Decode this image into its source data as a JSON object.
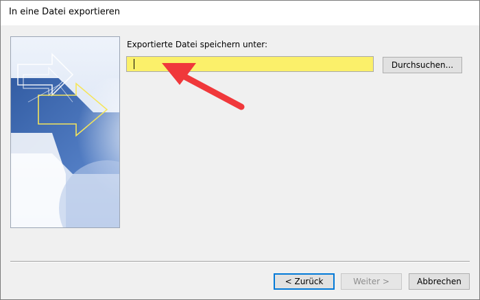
{
  "window": {
    "title": "In eine Datei exportieren"
  },
  "form": {
    "label": "Exportierte Datei speichern unter:",
    "path_value": "",
    "highlight_color": "#fbf06a"
  },
  "buttons": {
    "browse": "Durchsuchen...",
    "back": "< Zurück",
    "next": "Weiter >",
    "cancel": "Abbrechen"
  },
  "icons": {
    "wizard_image": "export-wizard-arrows-graphic",
    "annotation": "red-arrow-pointer"
  },
  "colors": {
    "annotation_arrow": "#f0383b",
    "wizard_blue": "#2f5aa8"
  }
}
